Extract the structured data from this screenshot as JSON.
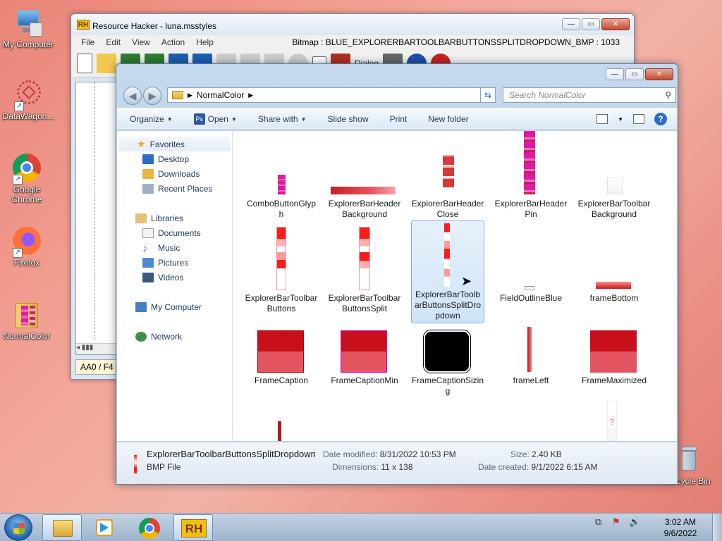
{
  "desktop": {
    "icons": [
      {
        "label": "My Computer"
      },
      {
        "label": "DataWagon..."
      },
      {
        "label": "Google Chrome"
      },
      {
        "label": "Firefox"
      },
      {
        "label": "NormalColor"
      },
      {
        "label": "Recycle Bin"
      }
    ]
  },
  "resource_hacker": {
    "logo": "RH",
    "title": "Resource Hacker - luna.msstyles",
    "menu": [
      "File",
      "Edit",
      "View",
      "Action",
      "Help"
    ],
    "bitmap_label": "Bitmap : BLUE_EXPLORERBARTOOLBARBUTTONSSPLITDROPDOWN_BMP : 1033",
    "toolbar_dialog": "Dialog",
    "status": "AA0 / F4"
  },
  "explorer": {
    "address": {
      "crumb": "NormalColor"
    },
    "search": {
      "placeholder": "Search NormalColor"
    },
    "commands": {
      "organize": "Organize",
      "open": "Open",
      "share": "Share with",
      "slideshow": "Slide show",
      "print": "Print",
      "new_folder": "New folder"
    },
    "nav": {
      "favorites": "Favorites",
      "desktop": "Desktop",
      "downloads": "Downloads",
      "recent": "Recent Places",
      "libraries": "Libraries",
      "documents": "Documents",
      "music": "Music",
      "pictures": "Pictures",
      "videos": "Videos",
      "computer": "My Computer",
      "network": "Network"
    },
    "files": [
      "ComboButtonGlyph",
      "ExplorerBarHeaderBackground",
      "ExplorerBarHeaderClose",
      "ExplorerBarHeaderPin",
      "ExplorerBarToolbarBackground",
      "ExplorerBarToolbarButtons",
      "ExplorerBarToolbarButtonsSplit",
      "ExplorerBarToolbarButtonsSplitDropdown",
      "FieldOutlineBlue",
      "frameBottom",
      "FrameCaption",
      "FrameCaptionMin",
      "FrameCaptionSizing",
      "frameLeft",
      "FrameMaximized"
    ],
    "details": {
      "name": "ExplorerBarToolbarButtonsSplitDropdown",
      "type": "BMP File",
      "modified_label": "Date modified:",
      "modified": "8/31/2022 10:53 PM",
      "dimensions_label": "Dimensions:",
      "dimensions": "11 x 138",
      "size_label": "Size:",
      "size": "2.40 KB",
      "created_label": "Date created:",
      "created": "9/1/2022 6:15 AM"
    }
  },
  "taskbar": {
    "time": "3:02 AM",
    "date": "9/6/2022",
    "rh_label": "RH"
  },
  "colors": {
    "selection": "#cfe4f8",
    "accent": "#2d6cc4"
  }
}
